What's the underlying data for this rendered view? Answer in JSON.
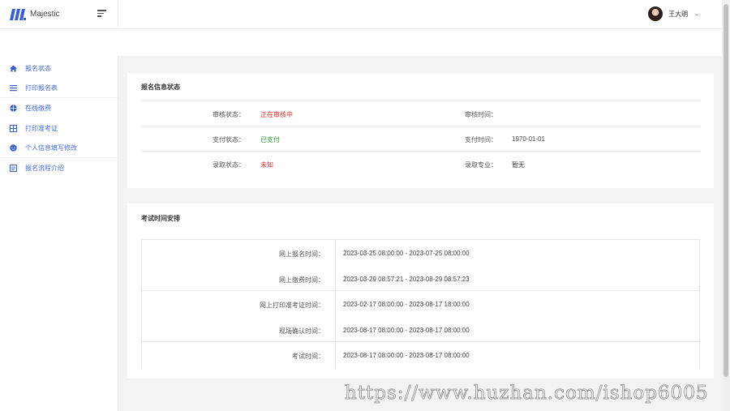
{
  "brand": {
    "name": "Majestic",
    "logo_color": "#3b5fc9"
  },
  "user": {
    "name": "王大明"
  },
  "sidebar": {
    "accent_color": "#4a6fd8",
    "items": [
      {
        "label": "报名状态",
        "icon": "home-icon"
      },
      {
        "label": "打印报名表",
        "icon": "list-icon"
      },
      {
        "label": "在线缴费",
        "icon": "globe-icon"
      },
      {
        "label": "打印准考证",
        "icon": "grid-icon"
      },
      {
        "label": "个人信息填写修改",
        "icon": "smile-icon"
      },
      {
        "label": "报名流程介绍",
        "icon": "document-icon"
      }
    ]
  },
  "status_card": {
    "title": "报名信息状态",
    "rows": [
      {
        "left_label": "审核状态：",
        "left_value": "正在审核中",
        "right_label": "审核时间：",
        "right_value": ""
      },
      {
        "left_label": "支付状态：",
        "left_value": "已支付",
        "right_label": "支付时间：",
        "right_value": "1970-01-01"
      },
      {
        "left_label": "录取状态：",
        "left_value": "未知",
        "right_label": "录取专业：",
        "right_value": "暂无"
      }
    ]
  },
  "schedule_card": {
    "title": "考试时间安排",
    "rows": [
      {
        "label": "网上报名时间：",
        "value": "2023-03-25 08:00:00 - 2023-07-25 08:00:00"
      },
      {
        "label": "网上缴费时间：",
        "value": "2023-03-29 08:57:21 - 2023-08-29 08:57:23"
      },
      {
        "label": "网上打印准考证时间：",
        "value": "2023-02-17 08:00:00 - 2023-08-17 18:00:00"
      },
      {
        "label": "现场确认时间：",
        "value": "2023-08-17 08:00:00 - 2023-08-17 08:00:00"
      },
      {
        "label": "考试时间：",
        "value": "2023-08-17 08:00:00 - 2023-08-17 08:00:00"
      }
    ]
  },
  "watermark": "https://www.huzhan.com/ishop6005"
}
